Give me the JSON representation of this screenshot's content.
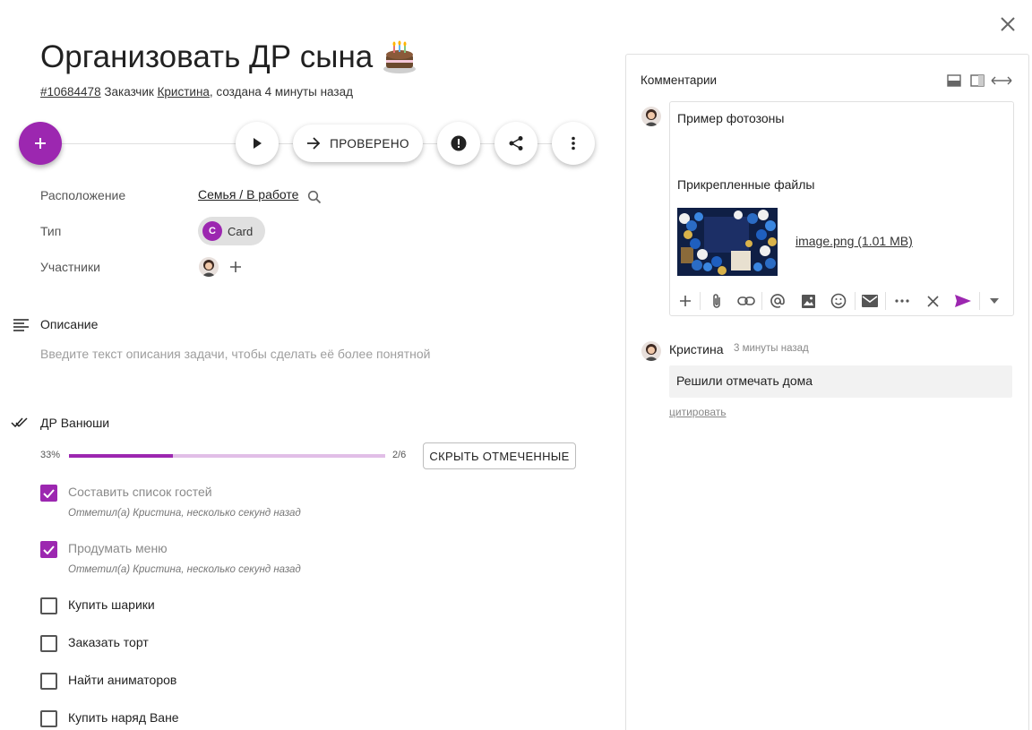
{
  "task": {
    "title": "Организовать ДР сына",
    "id": "#10684478",
    "customer_prefix": "Заказчик",
    "customer": "Кристина",
    "created": ", создана 4 минуты назад"
  },
  "toolbar": {
    "status_button": "ПРОВЕРЕНО"
  },
  "properties": {
    "location_label": "Расположение",
    "location_value": "Семья / В работе",
    "type_label": "Тип",
    "type_chip_letter": "C",
    "type_value": "Card",
    "participants_label": "Участники"
  },
  "description": {
    "title": "Описание",
    "placeholder": "Введите текст описания задачи, чтобы сделать её более понятной"
  },
  "checklist": {
    "title": "ДР Ванюши",
    "percent_label": "33%",
    "progress": 0.33,
    "count": "2/6",
    "hide_button": "СКРЫТЬ ОТМЕЧЕННЫЕ",
    "items": [
      {
        "label": "Составить список гостей",
        "checked": true,
        "note": "Отметил(а) Кристина, несколько секунд назад"
      },
      {
        "label": "Продумать меню",
        "checked": true,
        "note": "Отметил(а) Кристина, несколько секунд назад"
      },
      {
        "label": "Купить шарики",
        "checked": false
      },
      {
        "label": "Заказать торт",
        "checked": false
      },
      {
        "label": "Найти аниматоров",
        "checked": false
      },
      {
        "label": "Купить наряд Ване",
        "checked": false
      }
    ]
  },
  "comments": {
    "title": "Комментарии",
    "draft_text": "Пример фотозоны",
    "attachments_title": "Прикрепленные файлы",
    "file_link": "image.png (1.01 MB)",
    "list": [
      {
        "author": "Кристина",
        "time": "3 минуты назад",
        "text": "Решили отмечать дома",
        "quote": "цитировать"
      }
    ]
  },
  "colors": {
    "accent": "#9c27b0",
    "accent_light": "#e1bee7"
  },
  "icons": [
    "close-icon",
    "cake-emoji",
    "plus-icon",
    "play-icon",
    "arrow-right-icon",
    "alert-icon",
    "share-icon",
    "more-vert-icon",
    "search-icon",
    "description-icon",
    "double-check-icon",
    "checkbox-checked-icon",
    "checkbox-empty-icon",
    "layout-bottom-icon",
    "layout-side-icon",
    "expand-horizontal-icon",
    "attach-icon",
    "link-icon",
    "mention-icon",
    "image-icon",
    "emoji-icon",
    "mail-icon",
    "more-horiz-icon",
    "send-icon",
    "dropdown-icon"
  ]
}
